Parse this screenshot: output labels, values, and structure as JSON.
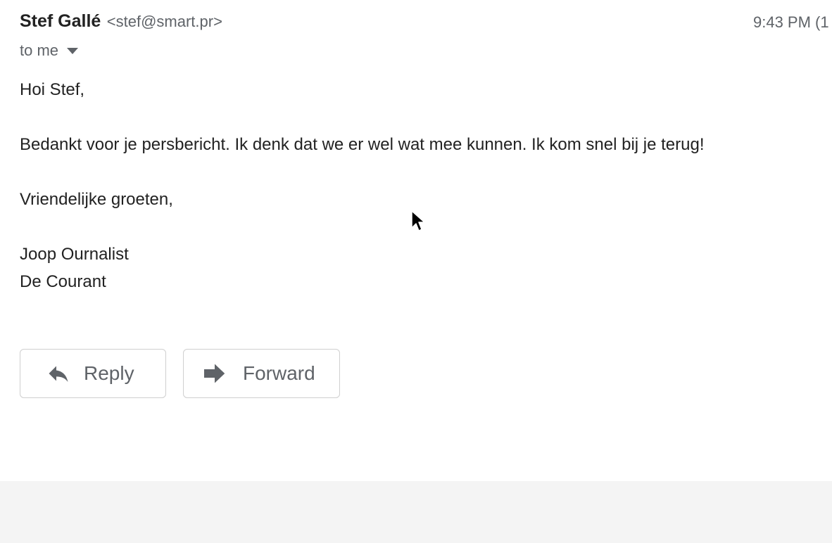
{
  "header": {
    "sender_name": "Stef Gallé",
    "sender_email": "<stef@smart.pr>",
    "timestamp": "9:43 PM (1",
    "recipient": "to me"
  },
  "message": {
    "greeting": "Hoi Stef,",
    "paragraph": "Bedankt voor je persbericht. Ik denk dat we er wel wat mee kunnen. Ik kom snel bij je terug!",
    "closing": "Vriendelijke groeten,",
    "signature_name": "Joop Ournalist",
    "signature_org": "De Courant"
  },
  "actions": {
    "reply_label": "Reply",
    "forward_label": "Forward",
    "reply_icon": "reply-arrow-icon",
    "forward_icon": "forward-arrow-icon"
  },
  "colors": {
    "text_primary": "#222222",
    "text_secondary": "#5f6368",
    "button_border": "#cfcfcf",
    "footer_background": "#f4f4f4"
  }
}
